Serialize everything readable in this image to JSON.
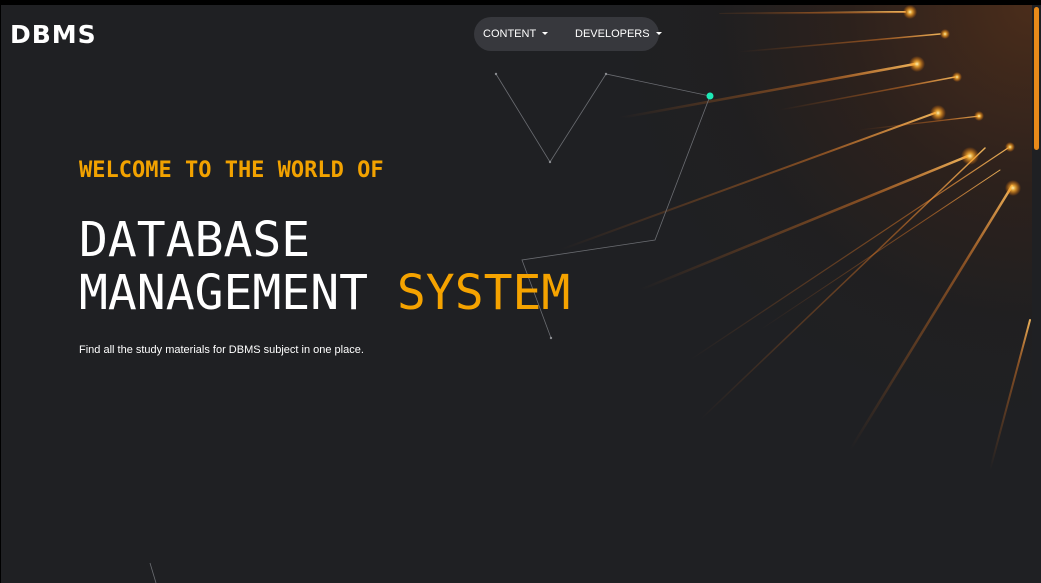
{
  "brand": {
    "logo_text": "DBMS"
  },
  "nav": {
    "items": [
      {
        "label": "CONTENT"
      },
      {
        "label": "DEVELOPERS"
      }
    ]
  },
  "hero": {
    "eyebrow": "WELCOME TO THE WORLD OF",
    "title_line1": "DATABASE",
    "title_line2_main": "MANAGEMENT",
    "title_line2_accent": "SYSTEM",
    "subtitle": "Find all the study materials for DBMS subject in one place."
  },
  "colors": {
    "accent": "#f5a300",
    "background": "#1f2023",
    "nav_pill": "#37383d",
    "network_node": "#1de9b6",
    "scrollbar": "#e88a1a"
  }
}
